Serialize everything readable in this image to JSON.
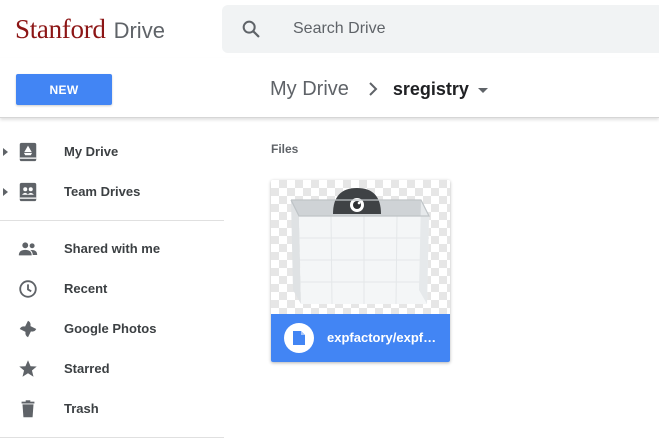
{
  "header": {
    "logo_brand": "Stanford",
    "logo_product": "Drive",
    "search_placeholder": "Search Drive",
    "search_icon": "search-icon"
  },
  "toolbar": {
    "new_label": "NEW",
    "breadcrumb_root": "My Drive",
    "breadcrumb_current": "sregistry"
  },
  "sidebar": {
    "items": [
      {
        "label": "My Drive",
        "icon": "my-drive-icon",
        "expandable": true
      },
      {
        "label": "Team Drives",
        "icon": "team-drives-icon",
        "expandable": true
      },
      {
        "label": "Shared with me",
        "icon": "shared-icon",
        "expandable": false
      },
      {
        "label": "Recent",
        "icon": "clock-icon",
        "expandable": false
      },
      {
        "label": "Google Photos",
        "icon": "photos-icon",
        "expandable": false
      },
      {
        "label": "Starred",
        "icon": "star-icon",
        "expandable": false
      },
      {
        "label": "Trash",
        "icon": "trash-icon",
        "expandable": false
      }
    ]
  },
  "main": {
    "section_title": "Files",
    "files": [
      {
        "name": "expfactory/expfa…",
        "type_icon": "document-icon"
      }
    ]
  },
  "colors": {
    "brand": "#8c1515",
    "accent": "#4285f4",
    "icon_gray": "#5f6368"
  }
}
